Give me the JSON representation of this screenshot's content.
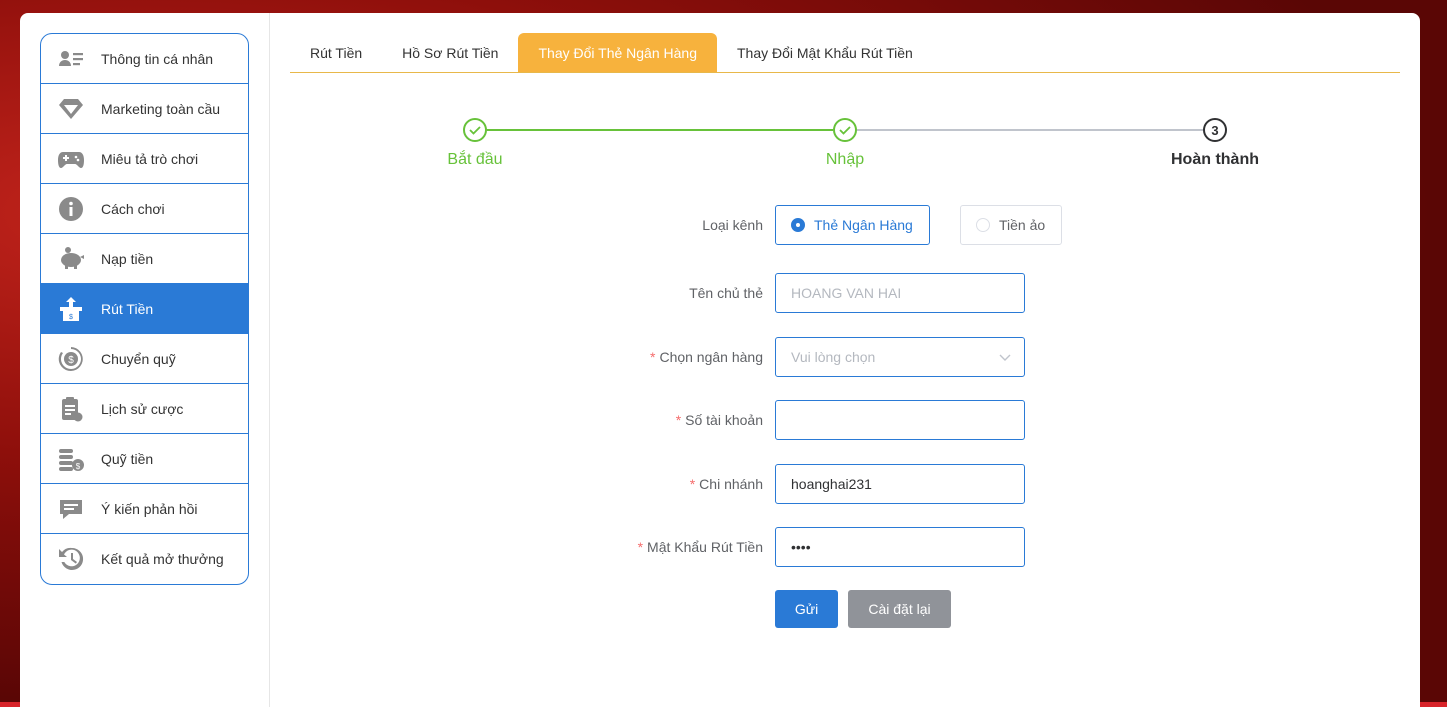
{
  "sidebar": {
    "items": [
      {
        "label": "Thông tin cá nhân",
        "icon": "user-card-icon"
      },
      {
        "label": "Marketing toàn cầu",
        "icon": "diamond-icon"
      },
      {
        "label": "Miêu tả trò chơi",
        "icon": "gamepad-icon"
      },
      {
        "label": "Cách chơi",
        "icon": "info-icon"
      },
      {
        "label": "Nạp tiền",
        "icon": "piggy-bank-icon"
      },
      {
        "label": "Rút Tiền",
        "icon": "withdraw-icon",
        "active": true
      },
      {
        "label": "Chuyển quỹ",
        "icon": "dollar-transfer-icon"
      },
      {
        "label": "Lịch sử cược",
        "icon": "clipboard-icon"
      },
      {
        "label": "Quỹ tiền",
        "icon": "coins-icon"
      },
      {
        "label": "Ý kiến phản hồi",
        "icon": "chat-bubble-icon"
      },
      {
        "label": "Kết quả mở thưởng",
        "icon": "history-icon"
      }
    ]
  },
  "tabs": [
    {
      "label": "Rút Tiền"
    },
    {
      "label": "Hồ Sơ Rút Tiền"
    },
    {
      "label": "Thay Đổi Thẻ Ngân Hàng",
      "active": true
    },
    {
      "label": "Thay Đổi Mật Khẩu Rút Tiền"
    }
  ],
  "steps": [
    {
      "label": "Bắt đầu",
      "status": "done"
    },
    {
      "label": "Nhập",
      "status": "done"
    },
    {
      "label": "Hoàn thành",
      "status": "current",
      "number": "3"
    }
  ],
  "form": {
    "channel": {
      "label": "Loại kênh",
      "options": [
        {
          "label": "Thẻ Ngân Hàng",
          "checked": true
        },
        {
          "label": "Tiền ảo",
          "checked": false
        }
      ]
    },
    "holder": {
      "label": "Tên chủ thẻ",
      "placeholder": "HOANG VAN HAI"
    },
    "bank": {
      "label": "Chọn ngân hàng",
      "required": "*",
      "placeholder": "Vui lòng chọn"
    },
    "account": {
      "label": "Số tài khoản",
      "required": "*",
      "value": ""
    },
    "branch": {
      "label": "Chi nhánh",
      "required": "*",
      "value": "hoanghai231"
    },
    "password": {
      "label": "Mật Khẩu Rút Tiền",
      "required": "*",
      "value": "••••"
    },
    "submit_label": "Gửi",
    "reset_label": "Cài đặt lại"
  },
  "colors": {
    "primary": "#2a7ad6",
    "tab_active": "#f7b23d",
    "step_done": "#67c23a",
    "required": "#f56c6c"
  }
}
